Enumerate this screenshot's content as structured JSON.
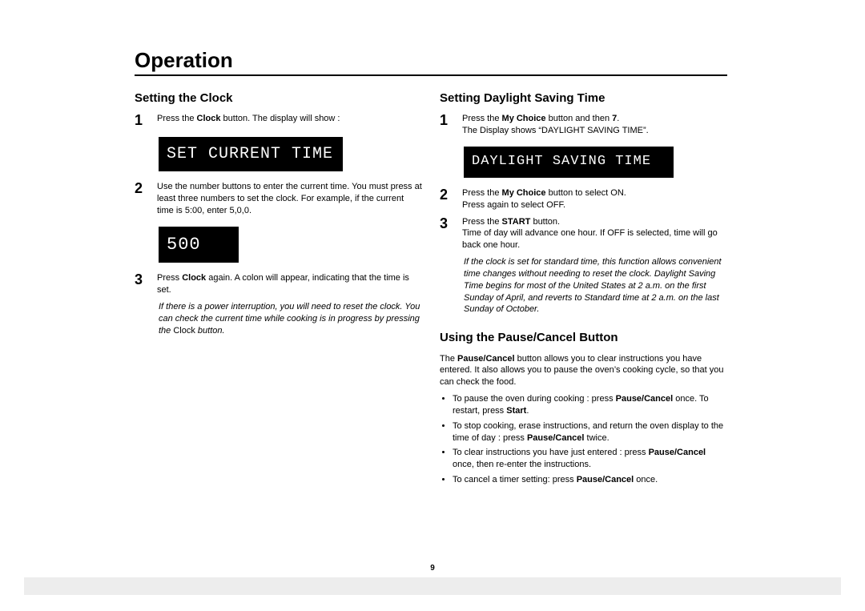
{
  "title": "Operation",
  "pageNumber": "9",
  "left": {
    "heading": "Setting the Clock",
    "step1_pre": "Press the ",
    "step1_b": "Clock",
    "step1_post": " button. The display will show :",
    "display1": "SET CURRENT TIME",
    "step2": "Use the number buttons to enter the current time. You must press at least three numbers to set the clock. For example, if the current time is 5:00, enter 5,0,0.",
    "display2": "500",
    "step3_pre": "Press ",
    "step3_b": "Clock",
    "step3_post": " again. A colon will appear, indicating that the time is set.",
    "note1": "If there is a power interruption, you will need to reset the clock. You can check the current time while cooking is in progress by pressing the ",
    "note1_nonital": "Clock",
    "note1_tail": " button."
  },
  "right": {
    "heading1": "Setting Daylight Saving Time",
    "s1a": "Press the ",
    "s1b": "My Choice",
    "s1c": " button and then ",
    "s1d": "7",
    "s1e": ".",
    "s1line2": "The Display shows “DAYLIGHT SAVING TIME”.",
    "display1": "DAYLIGHT SAVING TIME",
    "s2a": "Press the ",
    "s2b": "My Choice",
    "s2c": " button to select ON.",
    "s2line2": "Press again to select OFF.",
    "s3a": "Press the ",
    "s3b": "START",
    "s3c": " button.",
    "s3line2": "Time of day will advance one hour. If OFF is selected, time will go back one hour.",
    "note": "If the clock is set for standard time, this function  allows convenient time changes without needing to reset the clock. Daylight Saving Time begins for most of the United States at 2 a.m. on the first Sunday of April, and reverts to Standard time at 2 a.m. on the last Sunday of October.",
    "heading2": "Using the Pause/Cancel Button",
    "p_intro_a": "The ",
    "p_intro_b": "Pause/Cancel",
    "p_intro_c": " button allows you to clear instructions you have entered. It also allows you to pause the oven’s cooking cycle, so that you can check the food.",
    "b1a": "To pause the oven during cooking : press ",
    "b1b": "Pause/Cancel",
    "b1c": " once. To restart, press ",
    "b1d": "Start",
    "b1e": ".",
    "b2a": "To stop cooking, erase instructions, and return the oven display to the time of day : press ",
    "b2b": "Pause/Cancel",
    "b2c": " twice.",
    "b3a": "To clear instructions you have just entered : press ",
    "b3b": "Pause/Cancel",
    "b3c": " once, then re-enter the instructions.",
    "b4a": "To cancel a timer setting: press ",
    "b4b": "Pause/Cancel",
    "b4c": " once."
  }
}
